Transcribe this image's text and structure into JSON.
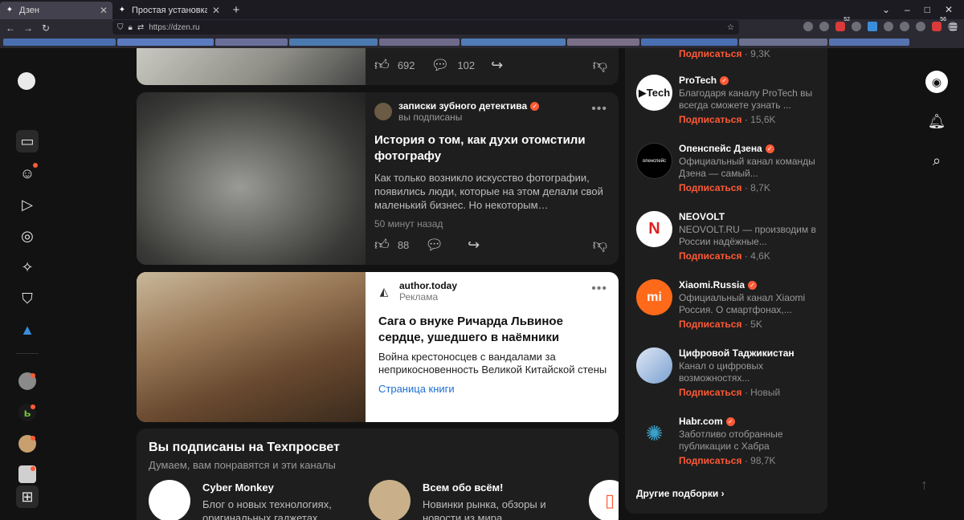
{
  "browser": {
    "tabs": [
      {
        "title": "Дзен",
        "active": true
      },
      {
        "title": "Простая установка ПО дл",
        "active": false
      }
    ],
    "url": "https://dzen.ru",
    "extension_badges": [
      "52",
      "56"
    ]
  },
  "feed": {
    "top_card": {
      "likes": "692",
      "comments": "102"
    },
    "article": {
      "channel": "записки зубного детектива",
      "status": "вы подписаны",
      "title": "История о том, как духи отомстили фотографу",
      "text": "Как только возникло искусство фотографии, появились люди, которые на этом делали свой маленький бизнес. Но некоторым…",
      "time": "50 минут назад",
      "likes": "88"
    },
    "ad": {
      "channel": "author.today",
      "label": "Реклама",
      "title": "Сага о внуке Ричарда Львиное сердце, ушедшего в наёмники",
      "text": "Война крестоносцев с вандалами за неприкосновенность Великой Китайской стены",
      "link": "Страница книги"
    },
    "subscribed": {
      "title": "Вы подписаны на Техпросвет",
      "subtitle": "Думаем, вам понравятся и эти каналы",
      "items": [
        {
          "name": "Cyber Monkey",
          "desc": "Блог о новых технологиях, оригинальных гаджетах,..."
        },
        {
          "name": "Всем обо всём!",
          "desc": "Новинки рынка, обзоры и новости из мира..."
        }
      ]
    }
  },
  "sidebar": {
    "first_sub": {
      "link": "Подписаться",
      "count": "· 9,3K"
    },
    "channels": [
      {
        "name": "ProTech",
        "desc": "Благодаря каналу ProTech вы всегда сможете узнать ...",
        "link": "Подписаться",
        "count": "· 15,6K"
      },
      {
        "name": "Опенспейс Дзена",
        "desc": "Официальный канал команды Дзена — самый...",
        "link": "Подписаться",
        "count": "· 8,7K"
      },
      {
        "name": "NEOVOLT",
        "desc": "NEOVOLT.RU — производим в России надёжные...",
        "link": "Подписаться",
        "count": "· 4,6K"
      },
      {
        "name": "Xiaomi.Russia",
        "desc": "Официальный канал Xiaomi Россия. О смартфонах,...",
        "link": "Подписаться",
        "count": "· 5K"
      },
      {
        "name": "Цифровой Таджикистан",
        "desc": "Канал о цифровых возможностях...",
        "link": "Подписаться",
        "count": "· Новый"
      },
      {
        "name": "Habr.com",
        "desc": "Заботливо отобранные публикации с Хабра",
        "link": "Подписаться",
        "count": "· 98,7K"
      }
    ],
    "more": "Другие подборки"
  }
}
